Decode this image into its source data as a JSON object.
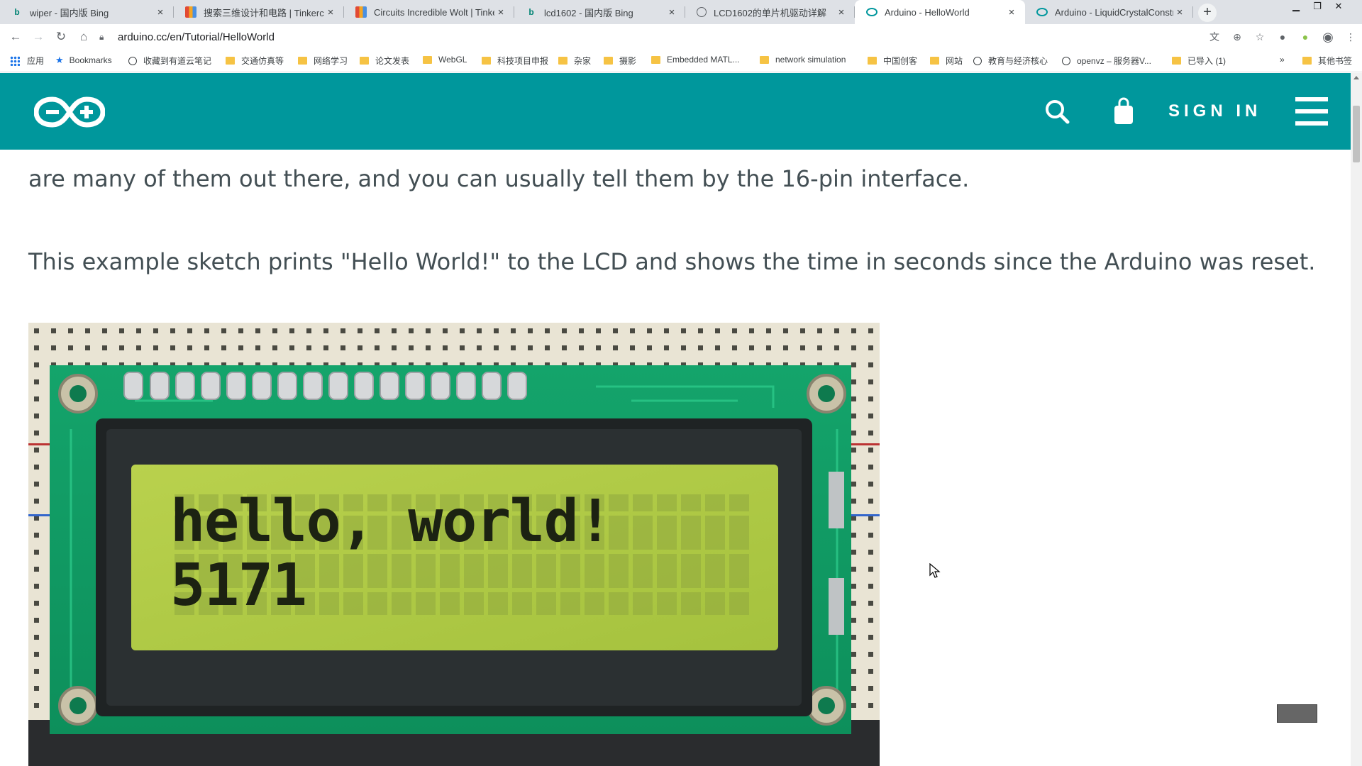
{
  "browser": {
    "tabs": [
      {
        "title": "wiper - 国内版 Bing",
        "icon": "bing-icon"
      },
      {
        "title": "搜索三维设计和电路 | Tinkercad",
        "icon": "tinkercad-icon"
      },
      {
        "title": "Circuits Incredible Wolt | Tinke",
        "icon": "tinkercad-icon"
      },
      {
        "title": "lcd1602 - 国内版 Bing",
        "icon": "bing-icon"
      },
      {
        "title": "LCD1602的单片机驱动详解",
        "icon": "globe-icon"
      },
      {
        "title": "Arduino - HelloWorld",
        "icon": "arduino-icon",
        "active": true
      },
      {
        "title": "Arduino - LiquidCrystalConstr",
        "icon": "arduino-icon"
      }
    ],
    "url": "arduino.cc/en/Tutorial/HelloWorld",
    "bookmarks": [
      {
        "label": "应用",
        "type": "apps"
      },
      {
        "label": "Bookmarks",
        "type": "star"
      },
      {
        "label": "收藏到有道云笔记",
        "type": "globe"
      },
      {
        "label": "交通仿真等",
        "type": "folder"
      },
      {
        "label": "网络学习",
        "type": "folder"
      },
      {
        "label": "论文发表",
        "type": "folder"
      },
      {
        "label": "WebGL",
        "type": "folder"
      },
      {
        "label": "科技项目申报",
        "type": "folder"
      },
      {
        "label": "杂家",
        "type": "folder"
      },
      {
        "label": "摄影",
        "type": "folder"
      },
      {
        "label": "Embedded MATL...",
        "type": "folder"
      },
      {
        "label": "network simulation",
        "type": "folder"
      },
      {
        "label": "中国创客",
        "type": "folder"
      },
      {
        "label": "网站",
        "type": "folder"
      },
      {
        "label": "教育与经济核心",
        "type": "globe"
      },
      {
        "label": "openvz – 服务器V...",
        "type": "globe"
      },
      {
        "label": "已导入 (1)",
        "type": "folder"
      }
    ],
    "more_bookmarks": "»",
    "other_bookmarks": "其他书签"
  },
  "site": {
    "signin_label": "SIGN IN",
    "brand_color": "#00979c"
  },
  "article": {
    "paragraph1": "are many of them out there, and you can usually tell them by the 16-pin interface.",
    "paragraph2": "This example sketch prints \"Hello World!\" to the LCD and shows the time in seconds since the Arduino was reset."
  },
  "lcd": {
    "line1": "hello, world!",
    "line2": "5171"
  }
}
